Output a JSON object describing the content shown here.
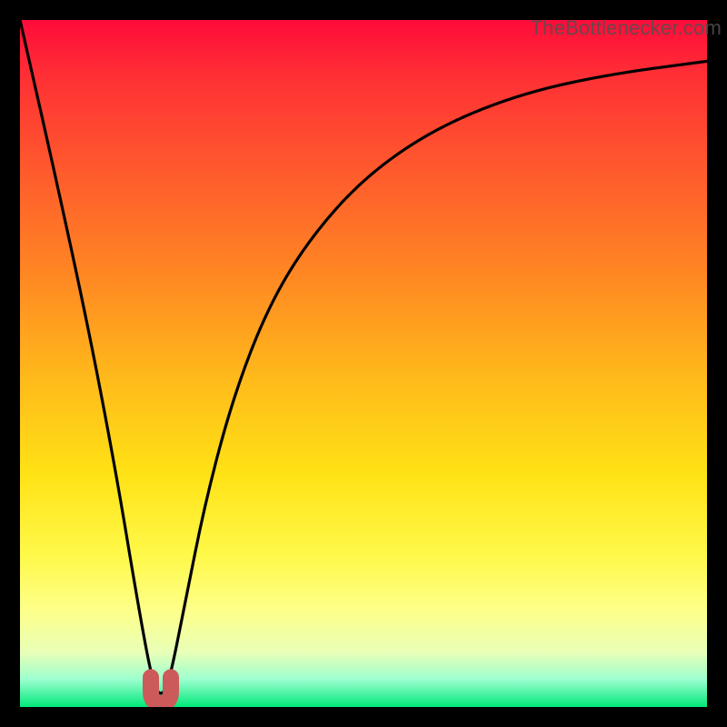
{
  "watermark": "TheBottlenecker.com",
  "chart_data": {
    "type": "line",
    "title": "",
    "xlabel": "",
    "ylabel": "",
    "xlim": [
      0,
      100
    ],
    "ylim": [
      0,
      100
    ],
    "grid": false,
    "series": [
      {
        "name": "bottleneck-curve",
        "x": [
          0,
          5,
          10,
          14,
          17,
          19,
          20,
          21,
          22,
          24,
          27,
          31,
          36,
          42,
          50,
          60,
          72,
          85,
          100
        ],
        "values": [
          100,
          78,
          55,
          34,
          16,
          5,
          2,
          2,
          5,
          15,
          30,
          45,
          58,
          68,
          77,
          84,
          89,
          92,
          94
        ]
      }
    ],
    "marker": {
      "name": "minimum-marker",
      "x": 20.5,
      "y": 2,
      "color": "#cc5a5a"
    },
    "background": "vertical-gradient-red-to-green"
  }
}
